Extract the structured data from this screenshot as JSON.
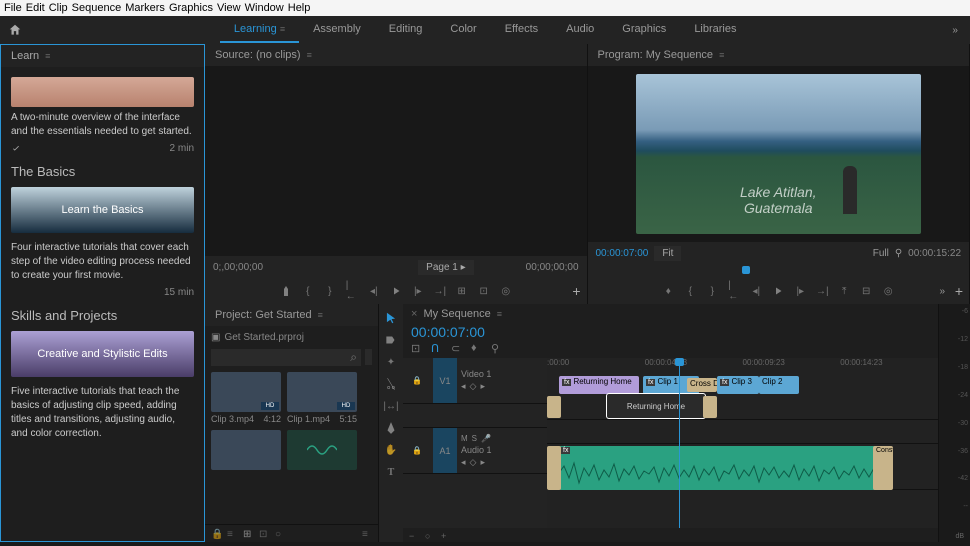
{
  "menu": [
    "File",
    "Edit",
    "Clip",
    "Sequence",
    "Markers",
    "Graphics",
    "View",
    "Window",
    "Help"
  ],
  "workspaces": [
    {
      "label": "Learning",
      "active": true
    },
    {
      "label": "Assembly",
      "active": false
    },
    {
      "label": "Editing",
      "active": false
    },
    {
      "label": "Color",
      "active": false
    },
    {
      "label": "Effects",
      "active": false
    },
    {
      "label": "Audio",
      "active": false
    },
    {
      "label": "Graphics",
      "active": false
    },
    {
      "label": "Libraries",
      "active": false
    }
  ],
  "learn": {
    "title": "Learn",
    "intro_desc": "A two-minute overview of the interface and the essentials needed to get started.",
    "intro_time": "2 min",
    "basics_title": "The Basics",
    "basics_card_label": "Learn the Basics",
    "basics_desc": "Four interactive tutorials that cover each step of the video editing process needed to create your first movie.",
    "basics_time": "15 min",
    "skills_title": "Skills and Projects",
    "skills_card_label": "Creative and Stylistic Edits",
    "skills_desc": "Five interactive tutorials that teach the basics of adjusting clip speed, adding titles and transitions, adjusting audio, and color correction."
  },
  "source": {
    "title": "Source: (no clips)",
    "tc_left": "0;,00;00;00",
    "tc_right": "00;00;00;00",
    "page": "Page 1"
  },
  "program": {
    "title": "Program: My Sequence",
    "overlay_line1": "Lake Atitlan,",
    "overlay_line2": "Guatemala",
    "tc_blue": "00:00:07:00",
    "fit": "Fit",
    "zoom": "Full",
    "tc_right": "00:00:15:22"
  },
  "project": {
    "title": "Project: Get Started",
    "folder": "Get Started.prproj",
    "search_placeholder": "",
    "bins": [
      {
        "name": "Clip 3.mp4",
        "dur": "4:12"
      },
      {
        "name": "Clip 1.mp4",
        "dur": "5:15"
      }
    ]
  },
  "timeline": {
    "title": "My Sequence",
    "tc": "00:00:07:00",
    "ruler": [
      ":00:00",
      "00:00:04:23",
      "00:00:09:23",
      "00:00:14:23"
    ],
    "v1": "V1",
    "video1": "Video 1",
    "a1": "A1",
    "audio1": "Audio 1",
    "m": "M",
    "s": "S",
    "clips": {
      "ret_home": "Returning Home",
      "ret_home_thumb": "Returning Home",
      "c1": "Clip 1",
      "c3": "Clip 3",
      "c2": "Clip 2",
      "cross": "Cross D",
      "cons": "Const",
      "fx": "fx"
    }
  },
  "meters": {
    "ticks": [
      "-6",
      "-12",
      "-18",
      "-24",
      "-30",
      "-36",
      "-42",
      "--"
    ],
    "unit": "dB"
  }
}
